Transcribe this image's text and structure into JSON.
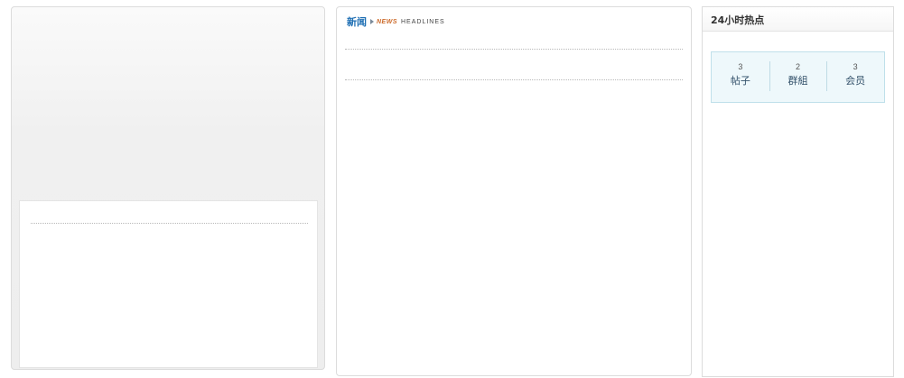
{
  "news": {
    "title": "新闻",
    "en_word": "NEWS",
    "en_sub": "HEADLINES"
  },
  "hot": {
    "title": "24小时热点",
    "stats": [
      {
        "count": "3",
        "label": "帖子"
      },
      {
        "count": "2",
        "label": "群組"
      },
      {
        "count": "3",
        "label": "会员"
      }
    ]
  },
  "colors": {
    "news_title": "#1d6eb3",
    "news_en": "#cc6a2a",
    "stats_bg": "#eef8fb",
    "stats_border": "#bfe0ea"
  },
  "icons": {
    "news_arrow": "triangle-right-icon"
  }
}
